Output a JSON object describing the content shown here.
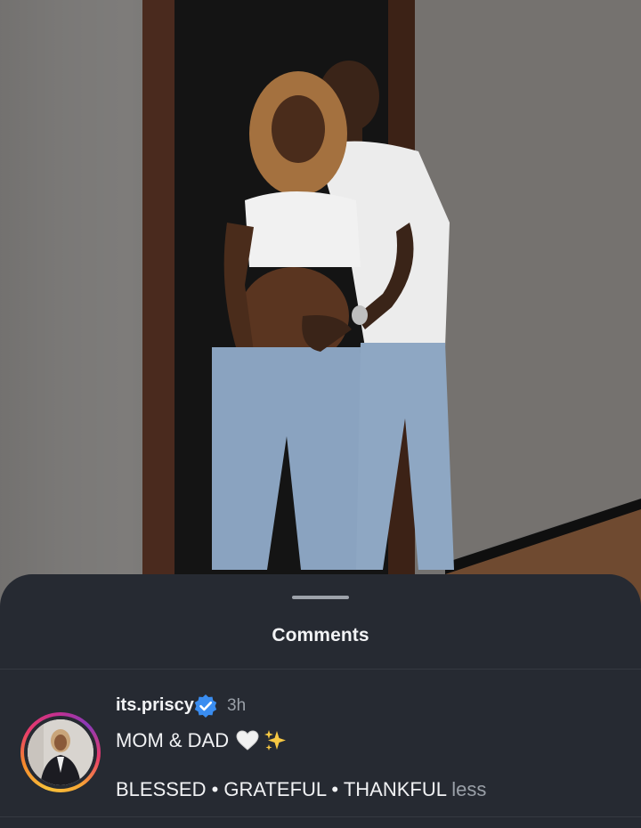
{
  "post": {
    "photo_description_icon": "photo-icon"
  },
  "sheet": {
    "title": "Comments"
  },
  "comment": {
    "username": "its.priscy",
    "verified_icon": "verified-badge-icon",
    "time": "3h",
    "text_line1": "MOM & DAD",
    "emojis": [
      "white-heart-icon",
      "sparkles-icon"
    ],
    "text_line2": "BLESSED • GRATEFUL • THANKFUL",
    "less_label": "less"
  },
  "colors": {
    "sheet_bg": "#262a32",
    "verified_blue": "#3a8df0",
    "secondary_text": "#9aa0a8"
  }
}
